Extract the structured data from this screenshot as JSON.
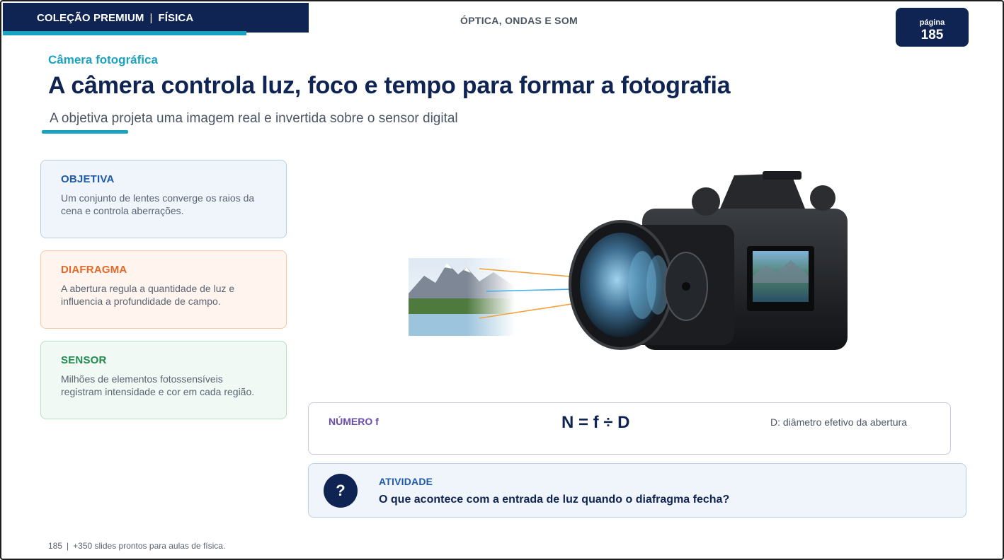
{
  "header": {
    "collection": "COLEÇÃO PREMIUM",
    "separator": "|",
    "subject": "FÍSICA",
    "topic": "ÓPTICA, ONDAS E SOM",
    "page_label": "página",
    "page_number": "185"
  },
  "hero": {
    "kicker": "Câmera fotográfica",
    "title": "A câmera controla luz, foco e tempo para formar a fotografia",
    "subtitle": "A objetiva projeta uma imagem real e invertida sobre o sensor digital"
  },
  "cards": [
    {
      "title": "OBJETIVA",
      "text": "Um conjunto de lentes converge os raios da cena e controla aberrações."
    },
    {
      "title": "DIAFRAGMA",
      "text": "A abertura regula a quantidade de luz e influencia a profundidade de campo."
    },
    {
      "title": "SENSOR",
      "text": "Milhões de elementos fotossensíveis registram intensidade e cor em cada região."
    }
  ],
  "formula": {
    "label": "NÚMERO f",
    "equation": "N = f ÷ D",
    "note": "D: diâmetro efetivo da abertura"
  },
  "activity": {
    "icon_symbol": "?",
    "title": "ATIVIDADE",
    "question": "O que acontece com a entrada de luz quando o diafragma fecha?"
  },
  "footer": {
    "page": "185",
    "separator": "|",
    "text": "+350 slides prontos para aulas de física."
  },
  "colors": {
    "navy": "#0f2452",
    "teal": "#1aa3c0",
    "blue": "#1e5aa8",
    "orange": "#e06a28",
    "green": "#1f8a4c",
    "purple": "#6a4bb0"
  },
  "icons": {
    "question": "question-icon",
    "camera": "camera-illustration"
  }
}
